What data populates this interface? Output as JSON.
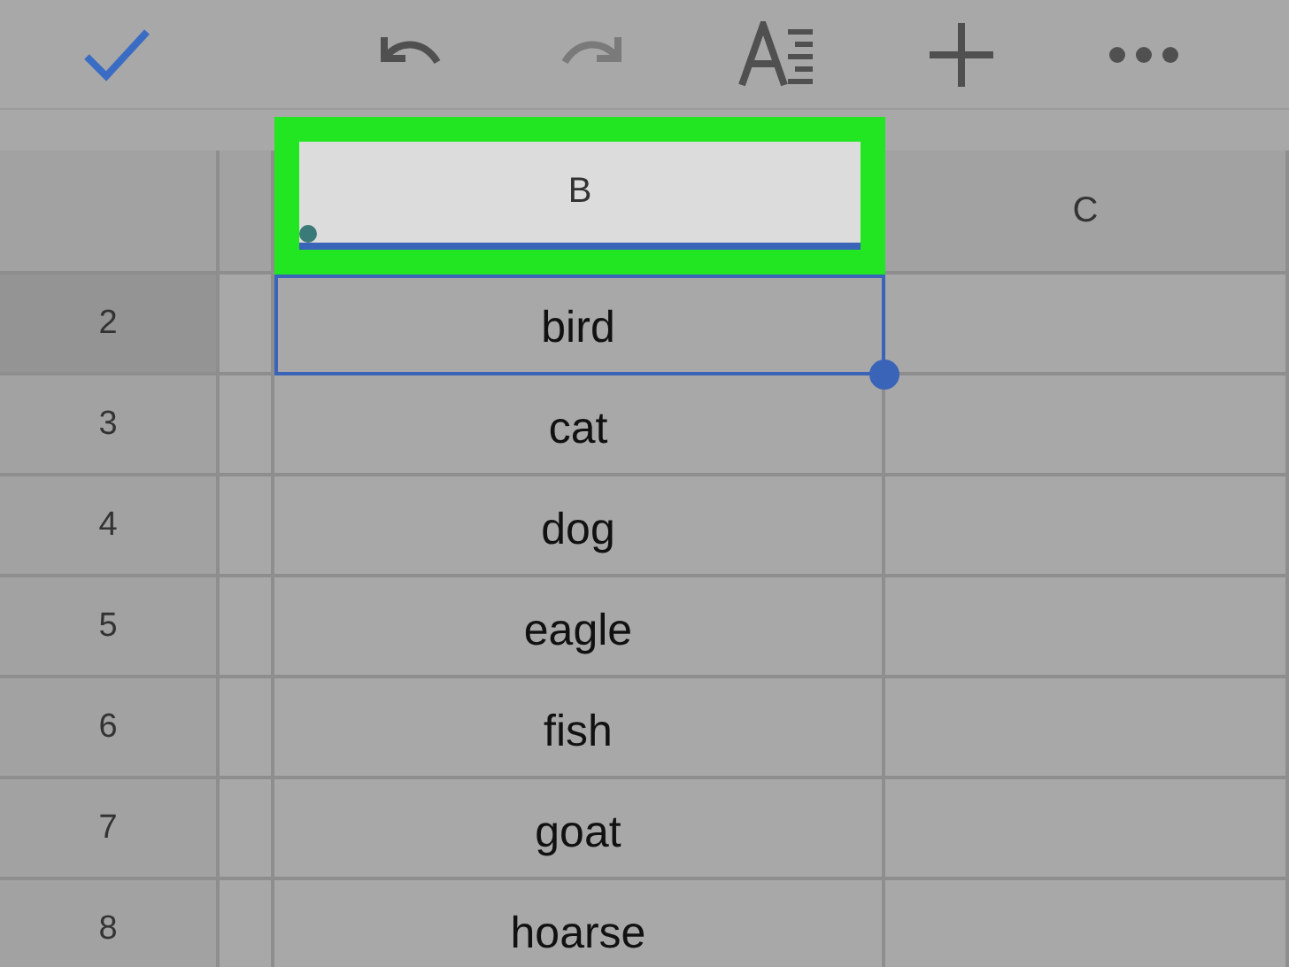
{
  "toolbar": [
    {
      "kind": "check",
      "disabled": false
    },
    {
      "kind": "undo",
      "disabled": false
    },
    {
      "kind": "redo",
      "disabled": true
    },
    {
      "kind": "format",
      "disabled": false
    },
    {
      "kind": "add",
      "disabled": false
    },
    {
      "kind": "more",
      "disabled": false
    }
  ],
  "columns": [
    {
      "label": "B",
      "selected": true
    },
    {
      "label": "C",
      "selected": false
    }
  ],
  "rows": [
    {
      "number": "2",
      "value": "bird",
      "selected": true
    },
    {
      "number": "3",
      "value": "cat",
      "selected": false
    },
    {
      "number": "4",
      "value": "dog",
      "selected": false
    },
    {
      "number": "5",
      "value": "eagle",
      "selected": false
    },
    {
      "number": "6",
      "value": "fish",
      "selected": false
    },
    {
      "number": "7",
      "value": "goat",
      "selected": false
    },
    {
      "number": "8",
      "value": "hoarse",
      "selected": false
    }
  ]
}
